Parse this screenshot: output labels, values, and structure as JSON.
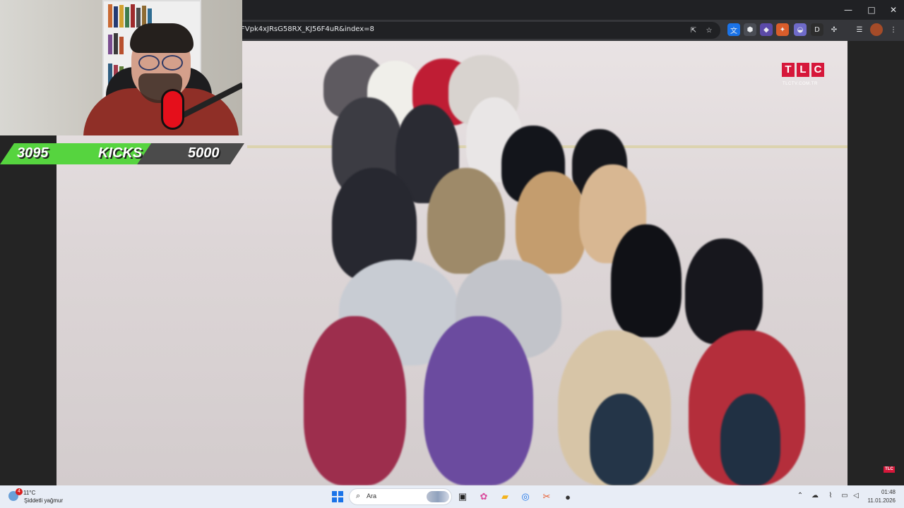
{
  "browser": {
    "url_text": "FVpk4xJRsG58RX_KJ56F4uR&index=8",
    "window_controls": {
      "minimize": "—",
      "restore": "□",
      "close": "✕"
    }
  },
  "video": {
    "channel_logo_letters": [
      "T",
      "L",
      "C"
    ],
    "channel_url": "TLCTV.COM.TR",
    "corner_logo": "TLC"
  },
  "stream_overlay": {
    "goal": {
      "current": "3095",
      "label": "KICKS",
      "target": "5000",
      "progress_fraction": 0.619,
      "fill_color": "#56d43f"
    }
  },
  "taskbar": {
    "weather": {
      "temperature": "11°C",
      "condition": "Şiddetli yağmur",
      "alert_count": "4"
    },
    "search_placeholder": "Ara",
    "clock": {
      "time": "01:48",
      "date": "11.01.2026"
    }
  }
}
